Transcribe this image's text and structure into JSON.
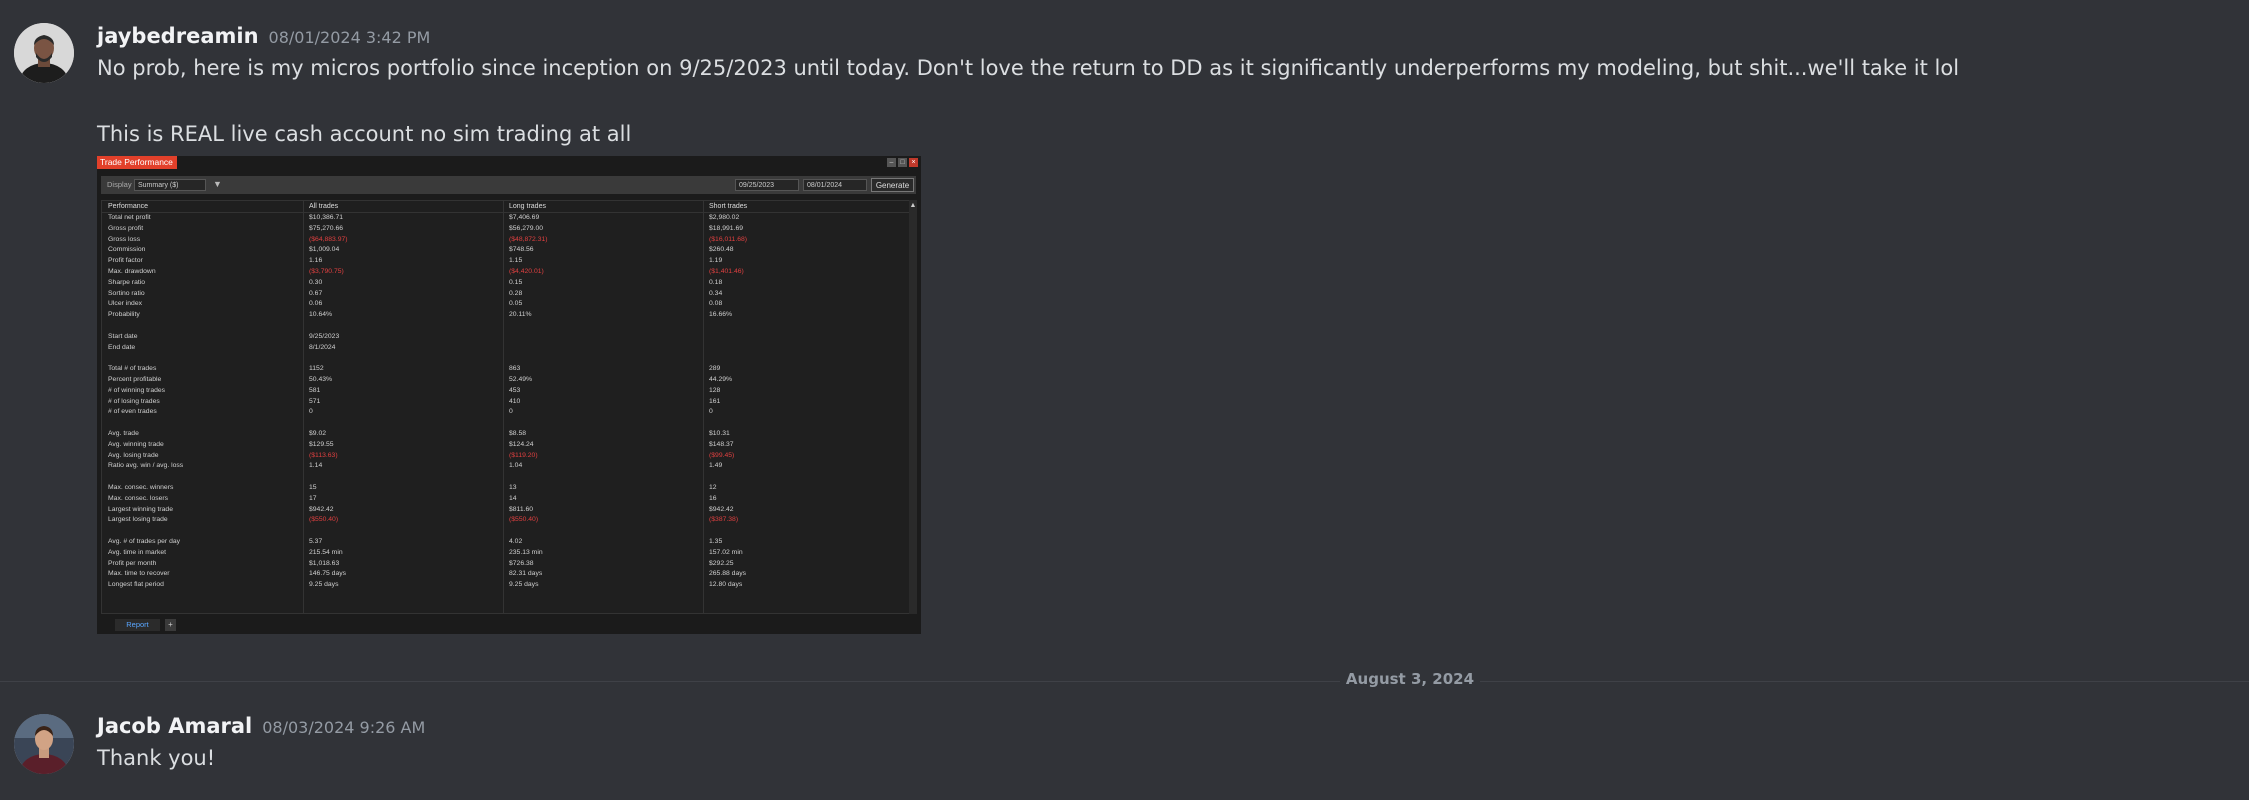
{
  "messages": [
    {
      "username": "jaybedreamin",
      "timestamp": "08/01/2024 3:42 PM",
      "line1": "No prob, here is my micros portfolio since inception on 9/25/2023 until today. Don't love the return to DD as it significantly underperforms my modeling, but shit...we'll take it lol",
      "line2": "This is REAL live cash account no sim trading at all"
    },
    {
      "username": "Jacob Amaral",
      "timestamp": "08/03/2024 9:26 AM",
      "line1": "Thank you!"
    }
  ],
  "date_divider": "August 3, 2024",
  "attachment": {
    "window_title": "Trade Performance",
    "display_label": "Display",
    "display_value": "Summary ($)",
    "date_from": "09/25/2023",
    "date_to": "08/01/2024",
    "generate_label": "Generate",
    "tab_label": "Report",
    "tab_add": "+",
    "columns": [
      "Performance",
      "All trades",
      "Long trades",
      "Short trades"
    ],
    "rows": [
      [
        "Total net profit",
        "$10,386.71",
        "$7,406.69",
        "$2,980.02"
      ],
      [
        "Gross profit",
        "$75,270.66",
        "$56,279.00",
        "$18,991.69"
      ],
      [
        "Gross loss",
        "($64,883.97)",
        "($48,872.31)",
        "($16,011.68)"
      ],
      [
        "Commission",
        "$1,009.04",
        "$748.56",
        "$260.48"
      ],
      [
        "Profit factor",
        "1.16",
        "1.15",
        "1.19"
      ],
      [
        "Max. drawdown",
        "($3,790.75)",
        "($4,420.01)",
        "($1,401.46)"
      ],
      [
        "Sharpe ratio",
        "0.30",
        "0.15",
        "0.18"
      ],
      [
        "Sortino ratio",
        "0.67",
        "0.28",
        "0.34"
      ],
      [
        "Ulcer index",
        "0.06",
        "0.05",
        "0.08"
      ],
      [
        "Probability",
        "10.64%",
        "20.11%",
        "16.66%"
      ],
      [
        "",
        "",
        "",
        ""
      ],
      [
        "Start date",
        "9/25/2023",
        "",
        ""
      ],
      [
        "End date",
        "8/1/2024",
        "",
        ""
      ],
      [
        "",
        "",
        "",
        ""
      ],
      [
        "Total # of trades",
        "1152",
        "863",
        "289"
      ],
      [
        "Percent profitable",
        "50.43%",
        "52.49%",
        "44.29%"
      ],
      [
        "# of winning trades",
        "581",
        "453",
        "128"
      ],
      [
        "# of losing trades",
        "571",
        "410",
        "161"
      ],
      [
        "# of even trades",
        "0",
        "0",
        "0"
      ],
      [
        "",
        "",
        "",
        ""
      ],
      [
        "Avg. trade",
        "$9.02",
        "$8.58",
        "$10.31"
      ],
      [
        "Avg. winning trade",
        "$129.55",
        "$124.24",
        "$148.37"
      ],
      [
        "Avg. losing trade",
        "($113.63)",
        "($119.20)",
        "($99.45)"
      ],
      [
        "Ratio avg. win / avg. loss",
        "1.14",
        "1.04",
        "1.49"
      ],
      [
        "",
        "",
        "",
        ""
      ],
      [
        "Max. consec. winners",
        "15",
        "13",
        "12"
      ],
      [
        "Max. consec. losers",
        "17",
        "14",
        "16"
      ],
      [
        "Largest winning trade",
        "$942.42",
        "$811.60",
        "$942.42"
      ],
      [
        "Largest losing trade",
        "($550.40)",
        "($550.40)",
        "($387.38)"
      ],
      [
        "",
        "",
        "",
        ""
      ],
      [
        "Avg. # of trades per day",
        "5.37",
        "4.02",
        "1.35"
      ],
      [
        "Avg. time in market",
        "215.54 min",
        "235.13 min",
        "157.02 min"
      ],
      [
        "Profit per month",
        "$1,018.63",
        "$726.38",
        "$292.25"
      ],
      [
        "Max. time to recover",
        "146.75 days",
        "82.31 days",
        "265.88 days"
      ],
      [
        "Longest flat period",
        "9.25 days",
        "9.25 days",
        "12.80 days"
      ]
    ]
  },
  "colors": {
    "background": "#313338",
    "username": "#f2f3f5",
    "timestamp": "#949ba4",
    "negative_value": "#e04040",
    "window_title_bg": "#e2402a"
  }
}
